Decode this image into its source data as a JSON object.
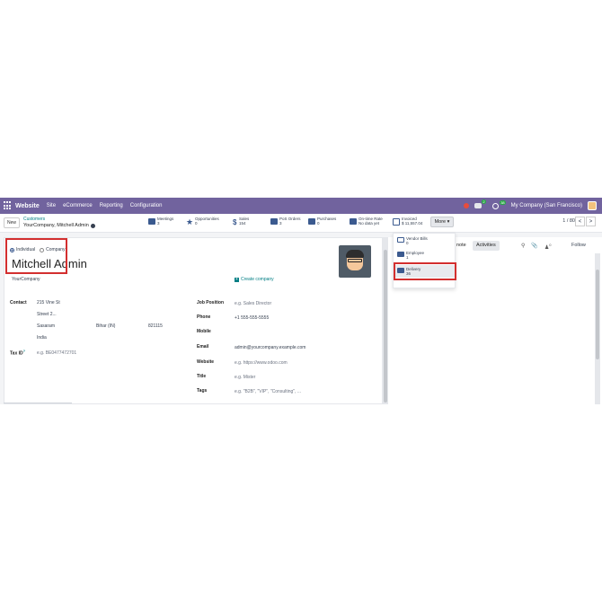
{
  "navbar": {
    "app_name": "Website",
    "menus": [
      "Site",
      "eCommerce",
      "Reporting",
      "Configuration"
    ],
    "chat_badge": "2",
    "activity_badge": "38",
    "company": "My Company (San Francisco)",
    "color": "#71639e"
  },
  "control": {
    "new_label": "New",
    "breadcrumb_parent": "Customers",
    "breadcrumb_current": "YourCompany, Mitchell Admin",
    "smart_buttons": [
      {
        "label": "Meetings",
        "value": "3"
      },
      {
        "label": "Opportunities",
        "value": "0"
      },
      {
        "label": "Sales",
        "value": "154"
      },
      {
        "label": "PoS Orders",
        "value": "3"
      },
      {
        "label": "Purchases",
        "value": "0"
      },
      {
        "label": "On-time Rate",
        "value": "No data yet"
      },
      {
        "label": "Invoiced",
        "value": "$ 11,557.04"
      }
    ],
    "more_label": "More ▾",
    "pager": "1 / 80",
    "prev": "<",
    "next": ">"
  },
  "form": {
    "type_individual": "Individual",
    "type_company": "Company",
    "name": "Mitchell Admin",
    "company_name": "YourCompany",
    "create_company": "Create company",
    "contact_label": "Contact",
    "street": "215 Vine St",
    "street2_placeholder": "Street 2...",
    "city": "Sasaram",
    "state": "Bihar (IN)",
    "zip": "821115",
    "country": "India",
    "tax_label": "Tax ID",
    "tax_sup": "?",
    "tax_placeholder": "e.g. BE0477472701",
    "job_label": "Job Position",
    "job_placeholder": "e.g. Sales Director",
    "phone_label": "Phone",
    "phone": "+1 555-555-5555",
    "mobile_label": "Mobile",
    "email_label": "Email",
    "email": "admin@yourcompany.example.com",
    "website_label": "Website",
    "website_placeholder": "e.g. https://www.odoo.com",
    "title_label": "Title",
    "title_placeholder": "e.g. Mister",
    "tags_label": "Tags",
    "tags_placeholder": "e.g. \"B2B\", \"VIP\", \"Consulting\", ..."
  },
  "dropdown": {
    "items": [
      {
        "label": "Vendor Bills",
        "value": "0"
      },
      {
        "label": "Employee",
        "value": "1"
      },
      {
        "label": "Delivery",
        "value": "36"
      }
    ]
  },
  "chatter": {
    "note": "note",
    "activities": "Activities",
    "followers_count": "0",
    "follow": "Follow"
  },
  "colors": {
    "accent": "#017e84",
    "highlight": "#d32f2f",
    "icon": "#3b5a8f"
  }
}
